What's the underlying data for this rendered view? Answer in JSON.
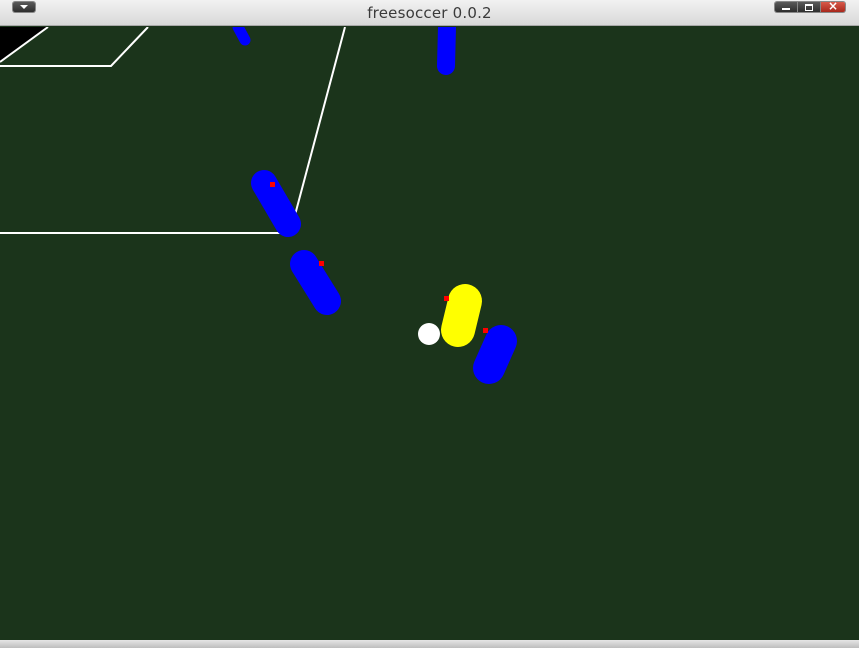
{
  "window": {
    "title": "freesoccer 0.0.2"
  },
  "icons": {
    "menu": "chevron-down-icon",
    "minimize": "minimize-icon",
    "maximize": "maximize-icon",
    "close": "close-icon"
  },
  "colors": {
    "pitch": "#1b341b",
    "lines": "#ffffff",
    "team_blue": "#0000ff",
    "team_yellow": "#ffff00",
    "player_marker": "#ff0000",
    "ball": "#ffffff"
  },
  "scene": {
    "players": [
      {
        "id": "blue-1",
        "team": "blue"
      },
      {
        "id": "blue-2",
        "team": "blue"
      },
      {
        "id": "blue-3",
        "team": "blue"
      },
      {
        "id": "blue-4",
        "team": "blue"
      },
      {
        "id": "blue-5",
        "team": "blue"
      },
      {
        "id": "yellow-1",
        "team": "yellow"
      }
    ],
    "ball": true
  }
}
